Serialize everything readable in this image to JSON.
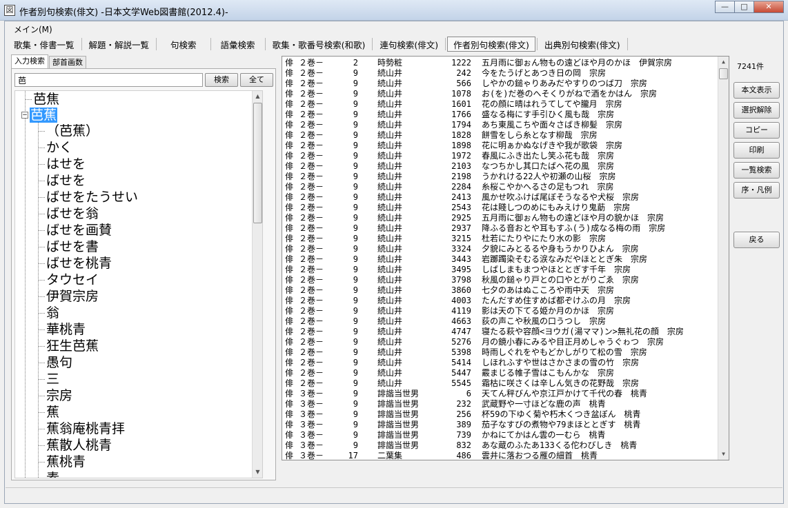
{
  "window": {
    "title": "作者別句検索(俳文) -日本文学Web図書館(2012.4)-",
    "min": "—",
    "max": "□",
    "close": "✕"
  },
  "menu": {
    "main": "メイン(M)"
  },
  "toolbar": {
    "items": [
      "歌集・俳書一覧",
      "解題・解説一覧",
      "句検索",
      "語彙検索",
      "歌集・歌番号検索(和歌)",
      "連句検索(俳文)",
      "作者別句検索(俳文)",
      "出典別句検索(俳文)"
    ]
  },
  "left": {
    "tabs": [
      "入力検索",
      "部首画数"
    ],
    "search_value": "芭",
    "search_button": "検索",
    "all_button": "全て",
    "tree": [
      "芭焦",
      "芭蕉",
      "（芭蕉）",
      "かく",
      "はせを",
      "ばせを",
      "ばせをたうせい",
      "ばせを翁",
      "ばせを画賛",
      "ばせを書",
      "ばせを桃青",
      "タウセイ",
      "伊賀宗房",
      "翁",
      "華桃青",
      "狂生芭蕉",
      "愚句",
      "三",
      "宗房",
      "蕉",
      "蕉翁庵桃青拝",
      "蕉散人桃青",
      "蕉桃青",
      "素"
    ]
  },
  "results": {
    "count": "7241件",
    "rows": [
      [
        "俳",
        "２巻－",
        "2",
        "時勢粧",
        "1222",
        "五月雨に御ぉん物もの遠どほや月のかほ　伊賀宗房"
      ],
      [
        "俳",
        "２巻－",
        "9",
        "続山井",
        "242",
        "今をたうげとあつき日の岡　宗房"
      ],
      [
        "俳",
        "２巻－",
        "9",
        "続山井",
        "566",
        "しやかの鎚ゃりあみだやすりのつば刀　宗房"
      ],
      [
        "俳",
        "２巻－",
        "9",
        "続山井",
        "1078",
        "お(を)だ巻のへそくりがねで酒をかはん　宗房"
      ],
      [
        "俳",
        "２巻－",
        "9",
        "続山井",
        "1601",
        "花の顔に晴はれうてしてや朧月　宗房"
      ],
      [
        "俳",
        "２巻－",
        "9",
        "続山井",
        "1766",
        "盛なる梅にす手引ひく風も哉　宗房"
      ],
      [
        "俳",
        "２巻－",
        "9",
        "続山井",
        "1794",
        "あち東風こちや面々さばき柳髪　宗房"
      ],
      [
        "俳",
        "２巻－",
        "9",
        "続山井",
        "1828",
        "餅雪をしら糸となす柳哉　宗房"
      ],
      [
        "俳",
        "２巻－",
        "9",
        "続山井",
        "1898",
        "花に明ぁかぬなげきや我が歌袋　宗房"
      ],
      [
        "俳",
        "２巻－",
        "9",
        "続山井",
        "1972",
        "春風にふき出たし笑ふ花も哉　宗房"
      ],
      [
        "俳",
        "２巻－",
        "9",
        "続山井",
        "2103",
        "なつちかし其口たばへ花の風　宗房"
      ],
      [
        "俳",
        "２巻－",
        "9",
        "続山井",
        "2198",
        "うかれける22人や初瀬の山桜　宗房"
      ],
      [
        "俳",
        "２巻－",
        "9",
        "続山井",
        "2284",
        "糸桜こやかへるさの足もつれ　宗房"
      ],
      [
        "俳",
        "２巻－",
        "9",
        "続山井",
        "2413",
        "風かせ吹ふけば尾ぼそうなるや犬桜　宗房"
      ],
      [
        "俳",
        "２巻－",
        "9",
        "続山井",
        "2543",
        "花は賤しつのめにもみえけり鬼莇　宗房"
      ],
      [
        "俳",
        "２巻－",
        "9",
        "続山井",
        "2925",
        "五月雨に御ぉん物もの遠どほや月の貌かほ　宗房"
      ],
      [
        "俳",
        "２巻－",
        "9",
        "続山井",
        "2937",
        "降ふる音おとや耳もすふ(う)成なる梅の雨　宗房"
      ],
      [
        "俳",
        "２巻－",
        "9",
        "続山井",
        "3215",
        "杜若にたりやにたり水の影　宗房"
      ],
      [
        "俳",
        "２巻－",
        "9",
        "続山井",
        "3324",
        "夕貌にみとるるや身もうかりひよん　宗房"
      ],
      [
        "俳",
        "２巻－",
        "9",
        "続山井",
        "3443",
        "岩躑躅染そむる涙なみだやほととぎ朱　宗房"
      ],
      [
        "俳",
        "２巻－",
        "9",
        "続山井",
        "3495",
        "しばしまもまつやほととぎす千年　宗房"
      ],
      [
        "俳",
        "２巻－",
        "9",
        "続山井",
        "3798",
        "秋風の鎚ゃり戸との口やとがりごゑ　宗房"
      ],
      [
        "俳",
        "２巻－",
        "9",
        "続山井",
        "3860",
        "七夕のあはぬこころや雨中天　宗房"
      ],
      [
        "俳",
        "２巻－",
        "9",
        "続山井",
        "4003",
        "たんだすめ住すめば都ぞけふの月　宗房"
      ],
      [
        "俳",
        "２巻－",
        "9",
        "続山井",
        "4119",
        "影は天の下てる姫か月のかほ　宗房"
      ],
      [
        "俳",
        "２巻－",
        "9",
        "続山井",
        "4663",
        "荻の声こや秋風の口うつし　宗房"
      ],
      [
        "俳",
        "２巻－",
        "9",
        "続山井",
        "4747",
        "寝たる萩や容顔<ヨウガ(湯ママ)ン>無礼花の顔　宗房"
      ],
      [
        "俳",
        "２巻－",
        "9",
        "続山井",
        "5276",
        "月の鏡小春にみるや目正月めしゃうぐゎつ　宗房"
      ],
      [
        "俳",
        "２巻－",
        "9",
        "続山井",
        "5398",
        "時雨しぐれをやもどかしがりて松の雪　宗房"
      ],
      [
        "俳",
        "２巻－",
        "9",
        "続山井",
        "5414",
        "しほれふすや世はさかさまの雪の竹　宗房"
      ],
      [
        "俳",
        "２巻－",
        "9",
        "続山井",
        "5447",
        "霰まじる帷子雪はこもんかな　宗房"
      ],
      [
        "俳",
        "２巻－",
        "9",
        "続山井",
        "5545",
        "霜枯に咲さくは辛しん気きの花野哉　宗房"
      ],
      [
        "俳",
        "３巻－",
        "9",
        "誹諧当世男",
        "6",
        "天てん秤びんや京江戸かけて千代の春　桃青"
      ],
      [
        "俳",
        "３巻－",
        "9",
        "誹諧当世男",
        "232",
        "武蔵野や一寸ほどな鹿の声　桃青"
      ],
      [
        "俳",
        "３巻－",
        "9",
        "誹諧当世男",
        "256",
        "杯59の下ゆく菊や朽木くつき盆ぼん　桃青"
      ],
      [
        "俳",
        "３巻－",
        "9",
        "誹諧当世男",
        "389",
        "茄子なすびの煮物や79まほととぎす　桃青"
      ],
      [
        "俳",
        "３巻－",
        "9",
        "誹諧当世男",
        "739",
        "かねにてかはん雲の一むら　桃青"
      ],
      [
        "俳",
        "３巻－",
        "9",
        "誹諧当世男",
        "832",
        "あな蔵のふたあ133くる佗わびしき　桃青"
      ],
      [
        "俳",
        "３巻－",
        "17",
        "二葉集",
        "486",
        "雲井に落おつる雁の細首　桃青"
      ]
    ]
  },
  "right_buttons": [
    "本文表示",
    "選択解除",
    "コピー",
    "印刷",
    "一覧検索",
    "序・凡例",
    "戻る"
  ],
  "icons": {
    "scroll_up": "▲",
    "scroll_down": "▼",
    "expander": "−",
    "app": "図"
  }
}
